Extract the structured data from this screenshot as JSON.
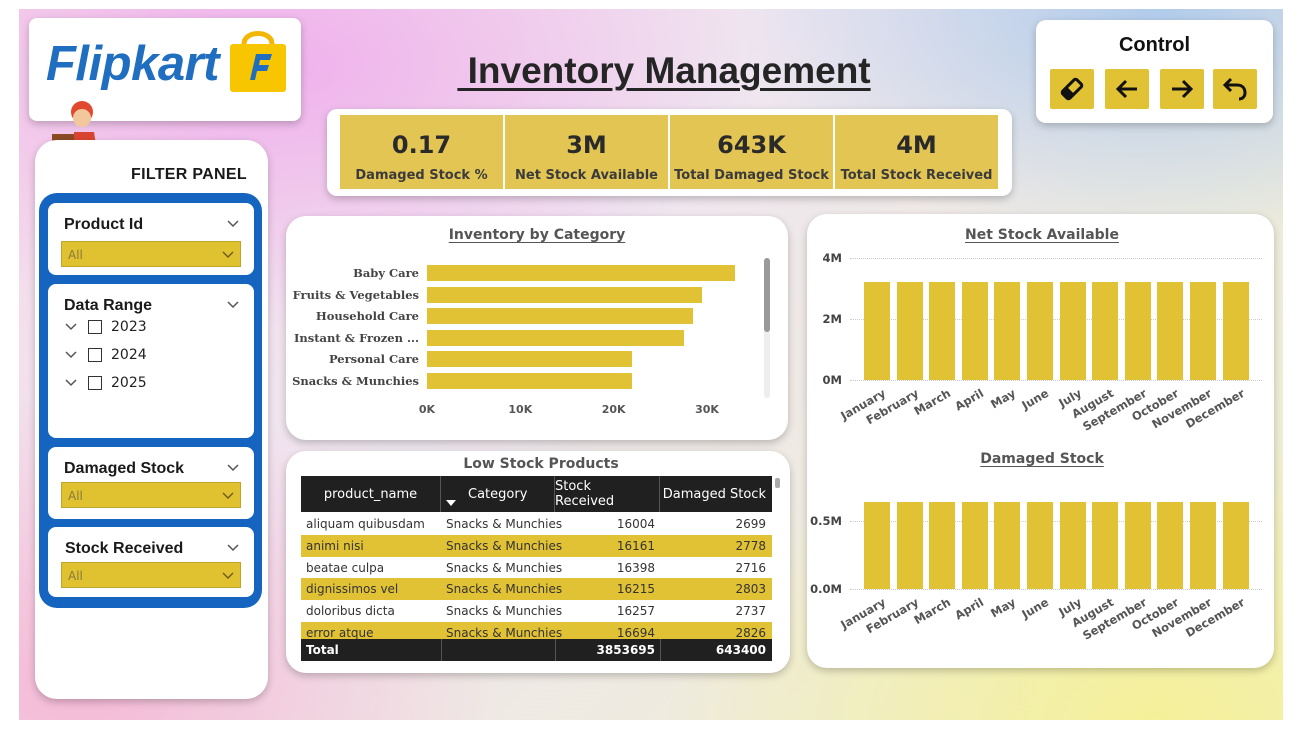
{
  "header": {
    "brand": "Flipkart",
    "title": " Inventory Management"
  },
  "control": {
    "title": "Control",
    "buttons": [
      {
        "name": "eraser-icon"
      },
      {
        "name": "arrow-left-icon"
      },
      {
        "name": "arrow-right-icon"
      },
      {
        "name": "undo-icon"
      }
    ]
  },
  "kpis": [
    {
      "value": "0.17",
      "label": "Damaged Stock %"
    },
    {
      "value": "3M",
      "label": "Net Stock Available"
    },
    {
      "value": "643K",
      "label": "Total Damaged Stock"
    },
    {
      "value": "4M",
      "label": "Total Stock Received"
    }
  ],
  "filters": {
    "title": "FILTER PANEL",
    "product_id": {
      "label": "Product Id",
      "value": "All"
    },
    "date_range": {
      "label": "Data Range",
      "years": [
        "2023",
        "2024",
        "2025"
      ]
    },
    "damaged_stock": {
      "label": "Damaged Stock",
      "value": "All"
    },
    "stock_received": {
      "label": "Stock Received",
      "value": "All"
    }
  },
  "table": {
    "title": "Low Stock Products",
    "columns": [
      "product_name",
      "Category",
      "Stock Received",
      "Damaged Stock"
    ],
    "rows": [
      [
        "aliquam quibusdam",
        "Snacks & Munchies",
        "16004",
        "2699"
      ],
      [
        "animi nisi",
        "Snacks & Munchies",
        "16161",
        "2778"
      ],
      [
        "beatae culpa",
        "Snacks & Munchies",
        "16398",
        "2716"
      ],
      [
        "dignissimos vel",
        "Snacks & Munchies",
        "16215",
        "2803"
      ],
      [
        "doloribus dicta",
        "Snacks & Munchies",
        "16257",
        "2737"
      ],
      [
        "error atque",
        "Snacks & Munchies",
        "16694",
        "2826"
      ]
    ],
    "total": {
      "label": "Total",
      "stock_received": "3853695",
      "damaged_stock": "643400"
    }
  },
  "colors": {
    "accent": "#e2c235",
    "frame": "#1565c0",
    "brand": "#1f6ec0",
    "header": "#202020"
  },
  "chart_data": [
    {
      "type": "bar",
      "orientation": "horizontal",
      "title": "Inventory by Category",
      "categories": [
        "Baby Care",
        "Fruits & Vegetables",
        "Household Care",
        "Instant & Frozen ...",
        "Personal Care",
        "Snacks & Munchies"
      ],
      "values": [
        33000,
        29500,
        28500,
        27500,
        22000,
        22000
      ],
      "xticks": [
        "0K",
        "10K",
        "20K",
        "30K"
      ],
      "xlim": [
        0,
        30000
      ]
    },
    {
      "type": "bar",
      "title": "Net Stock Available",
      "categories": [
        "January",
        "February",
        "March",
        "April",
        "May",
        "June",
        "July",
        "August",
        "September",
        "October",
        "November",
        "December"
      ],
      "values": [
        3.2,
        3.2,
        3.2,
        3.2,
        3.2,
        3.2,
        3.2,
        3.2,
        3.2,
        3.2,
        3.2,
        3.2
      ],
      "yticks": [
        "4M",
        "2M",
        "0M"
      ],
      "ylim": [
        0,
        4
      ],
      "grid": true
    },
    {
      "type": "bar",
      "title": "Damaged Stock",
      "categories": [
        "January",
        "February",
        "March",
        "April",
        "May",
        "June",
        "July",
        "August",
        "September",
        "October",
        "November",
        "December"
      ],
      "values": [
        0.64,
        0.64,
        0.64,
        0.64,
        0.64,
        0.64,
        0.64,
        0.64,
        0.64,
        0.64,
        0.64,
        0.64
      ],
      "yticks": [
        "0.5M",
        "0.0M"
      ],
      "grid": true
    }
  ]
}
